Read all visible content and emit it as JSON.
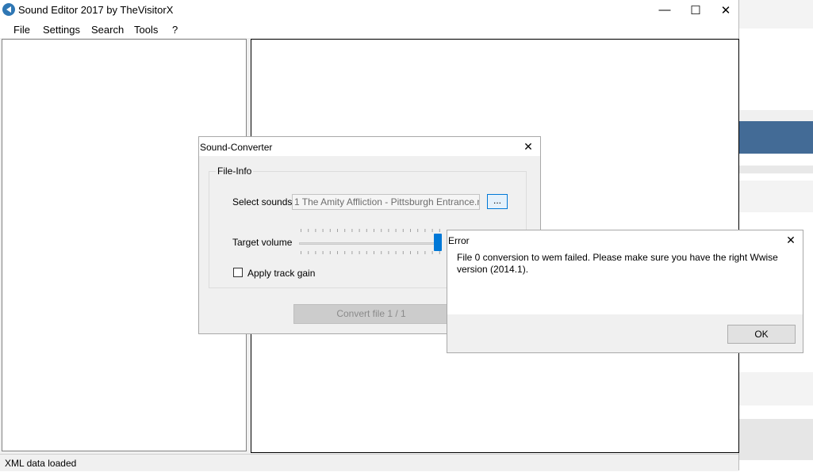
{
  "window": {
    "title": "Sound Editor 2017 by TheVisitorX",
    "minimize": "—",
    "maximize": "☐",
    "close": "✕"
  },
  "menu": [
    "File",
    "Settings",
    "Search",
    "Tools",
    "?"
  ],
  "status": "XML data loaded",
  "converter": {
    "title": "Sound-Converter",
    "close": "✕",
    "group_label": "File-Info",
    "select_label": "Select sounds",
    "select_value": "1 The Amity Affliction - Pittsburgh Entrance.m",
    "browse_label": "...",
    "volume_label": "Target volume",
    "volume_level": 1.0,
    "gain_label": "Apply track gain",
    "gain_checked": false,
    "convert_label": "Convert file 1 / 1"
  },
  "error": {
    "title": "Error",
    "close": "✕",
    "message": "File 0 conversion to wem failed. Please make sure you have the right Wwise version (2014.1).",
    "ok_label": "OK"
  },
  "colors": {
    "accent": "#0078d7",
    "app_icon": "#2f77b4",
    "bg_blue": "#436b96"
  }
}
